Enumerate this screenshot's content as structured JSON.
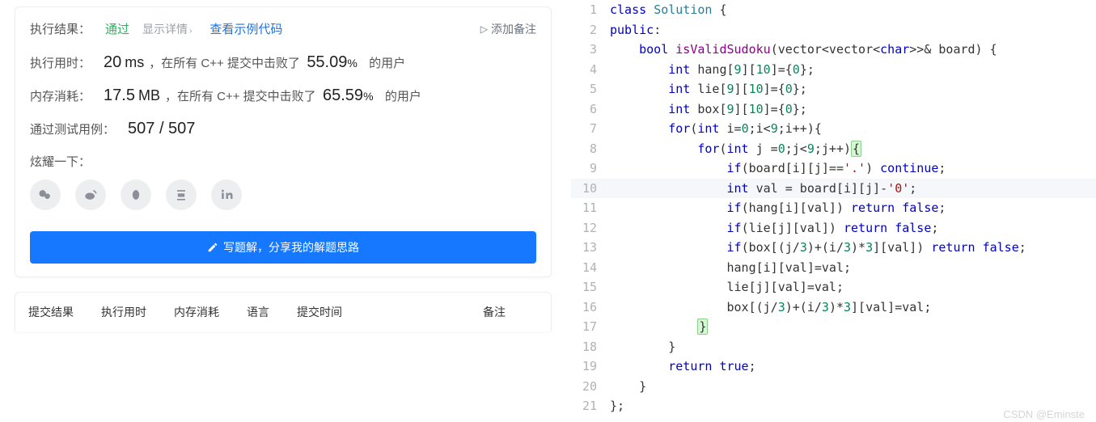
{
  "result": {
    "label": "执行结果：",
    "status": "通过",
    "show_detail": "显示详情",
    "view_sample": "查看示例代码",
    "add_note": "添加备注"
  },
  "stats": {
    "time_label": "执行用时：",
    "time_val": "20",
    "time_unit": "ms",
    "time_text_pre": "，在所有 C++ 提交中击败了",
    "time_pct": "55.09",
    "time_text_post": "的用户",
    "mem_label": "内存消耗：",
    "mem_val": "17.5",
    "mem_unit": "MB",
    "mem_text_pre": "，在所有 C++ 提交中击败了",
    "mem_pct": "65.59",
    "mem_text_post": "的用户",
    "cases_label": "通过测试用例：",
    "cases_val": "507 / 507"
  },
  "share": {
    "label": "炫耀一下："
  },
  "button": {
    "write": "写题解，分享我的解题思路"
  },
  "table": {
    "c1": "提交结果",
    "c2": "执行用时",
    "c3": "内存消耗",
    "c4": "语言",
    "c5": "提交时间",
    "c6": "备注"
  },
  "code": {
    "lines": [
      {
        "n": 1,
        "html": "<span class='kw2'>class</span> <span class='type'>Solution</span> {"
      },
      {
        "n": 2,
        "html": "<span class='kw2'>public</span>:"
      },
      {
        "n": 3,
        "html": "    <span class='kw'>bool</span> <span class='fn'>isValidSudoku</span>(vector&lt;vector&lt;<span class='kw'>char</span>&gt;&gt;&amp; board) {"
      },
      {
        "n": 4,
        "html": "        <span class='kw'>int</span> hang[<span class='num'>9</span>][<span class='num'>10</span>]={<span class='num'>0</span>};"
      },
      {
        "n": 5,
        "html": "        <span class='kw'>int</span> lie[<span class='num'>9</span>][<span class='num'>10</span>]={<span class='num'>0</span>};"
      },
      {
        "n": 6,
        "html": "        <span class='kw'>int</span> box[<span class='num'>9</span>][<span class='num'>10</span>]={<span class='num'>0</span>};"
      },
      {
        "n": 7,
        "html": "        <span class='kw2'>for</span>(<span class='kw'>int</span> i=<span class='num'>0</span>;i&lt;<span class='num'>9</span>;i++){"
      },
      {
        "n": 8,
        "html": "            <span class='kw2'>for</span>(<span class='kw'>int</span> j =<span class='num'>0</span>;j&lt;<span class='num'>9</span>;j++)<span class='brace-hl'>{</span>"
      },
      {
        "n": 9,
        "html": "                <span class='kw2'>if</span>(board[i][j]==<span class='str'>'.'</span>) <span class='kw2'>continue</span>;"
      },
      {
        "n": 10,
        "hl": true,
        "html": "                <span class='kw'>int</span> val = board[i][j]-<span class='str'>'0'</span>;"
      },
      {
        "n": 11,
        "html": "                <span class='kw2'>if</span>(hang[i][val]) <span class='kw2'>return</span> <span class='kw'>false</span>;"
      },
      {
        "n": 12,
        "html": "                <span class='kw2'>if</span>(lie[j][val]) <span class='kw2'>return</span> <span class='kw'>false</span>;"
      },
      {
        "n": 13,
        "html": "                <span class='kw2'>if</span>(box[(j/<span class='num'>3</span>)+(i/<span class='num'>3</span>)*<span class='num'>3</span>][val]) <span class='kw2'>return</span> <span class='kw'>false</span>;"
      },
      {
        "n": 14,
        "html": "                hang[i][val]=val;"
      },
      {
        "n": 15,
        "html": "                lie[j][val]=val;"
      },
      {
        "n": 16,
        "html": "                box[(j/<span class='num'>3</span>)+(i/<span class='num'>3</span>)*<span class='num'>3</span>][val]=val;"
      },
      {
        "n": 17,
        "html": "            <span class='brace-hl'>}</span>"
      },
      {
        "n": 18,
        "html": "        }"
      },
      {
        "n": 19,
        "html": "        <span class='kw2'>return</span> <span class='kw'>true</span>;"
      },
      {
        "n": 20,
        "html": "    }"
      },
      {
        "n": 21,
        "html": "};"
      }
    ]
  },
  "watermark": "CSDN @Eminste"
}
